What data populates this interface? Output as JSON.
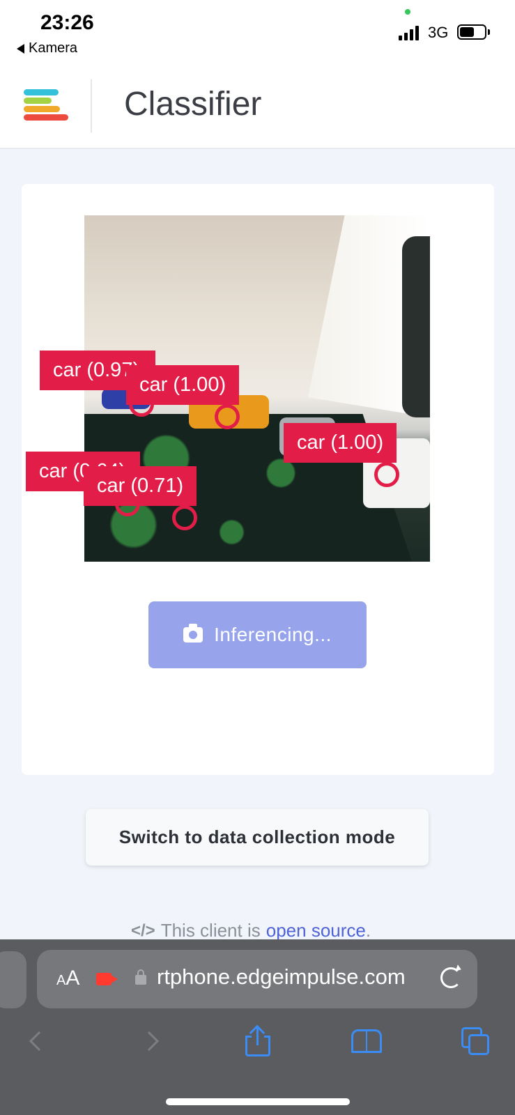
{
  "status_bar": {
    "time": "23:26",
    "back_app": "Kamera",
    "network": "3G",
    "battery_level": 0.58
  },
  "header": {
    "title": "Classifier",
    "logo_colors": [
      "#34c1d9",
      "#a3d344",
      "#f0a92b",
      "#ee4b3f"
    ]
  },
  "classifier": {
    "detections": [
      {
        "label": "car (0.97)",
        "dot_visible": true
      },
      {
        "label": "car (1.00)",
        "dot_visible": true
      },
      {
        "label": "car (1.00)",
        "dot_visible": true
      },
      {
        "label": "car (0.64)",
        "dot_visible": true
      },
      {
        "label": "car (0.71)",
        "dot_visible": true
      }
    ],
    "detection_color": "#e11d48",
    "button_label": "Inferencing...",
    "button_icon": "camera-icon"
  },
  "switch_button": {
    "label": "Switch to data collection mode"
  },
  "footer": {
    "prefix": "This client is",
    "link": "open source",
    "suffix": ".",
    "icon": "code-icon"
  },
  "browser": {
    "aa_label_small": "A",
    "aa_label_large": "A",
    "url": "rtphone.edgeimpulse.com",
    "icons": [
      "back-icon",
      "forward-icon",
      "share-icon",
      "bookmarks-icon",
      "tabs-icon"
    ],
    "accent": "#3b8cf5"
  }
}
